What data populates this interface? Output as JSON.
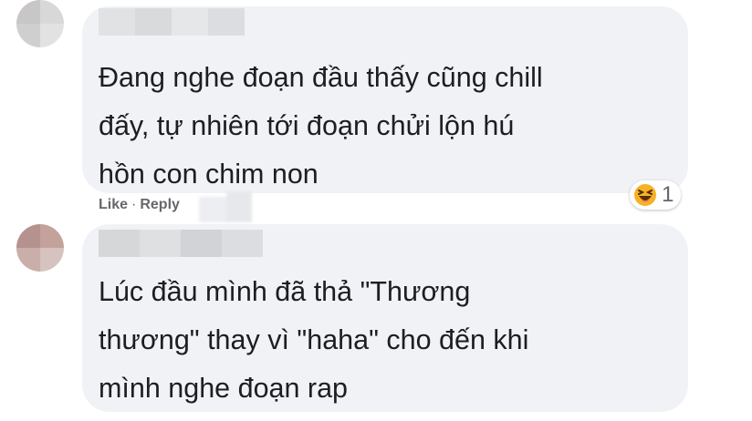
{
  "comments": [
    {
      "text_lines": [
        "Đang nghe đoạn đầu thấy cũng chill",
        "đấy, tự nhiên tới đoạn chửi lộn hú",
        "hồn con chim non"
      ],
      "actions": {
        "like": "Like",
        "separator": "·",
        "reply": "Reply"
      },
      "reaction": {
        "icon": "haha-emoji-icon",
        "count": "1"
      }
    },
    {
      "text_lines": [
        "Lúc đầu mình đã thả \"Thương",
        "thương\" thay vì \"haha\" cho đến khi",
        "mình nghe đoạn rap"
      ]
    }
  ],
  "colors": {
    "bubble": "#f0f2f5",
    "text": "#1c1e21",
    "secondary_text": "#65676b",
    "haha_face": "#f7b125"
  }
}
